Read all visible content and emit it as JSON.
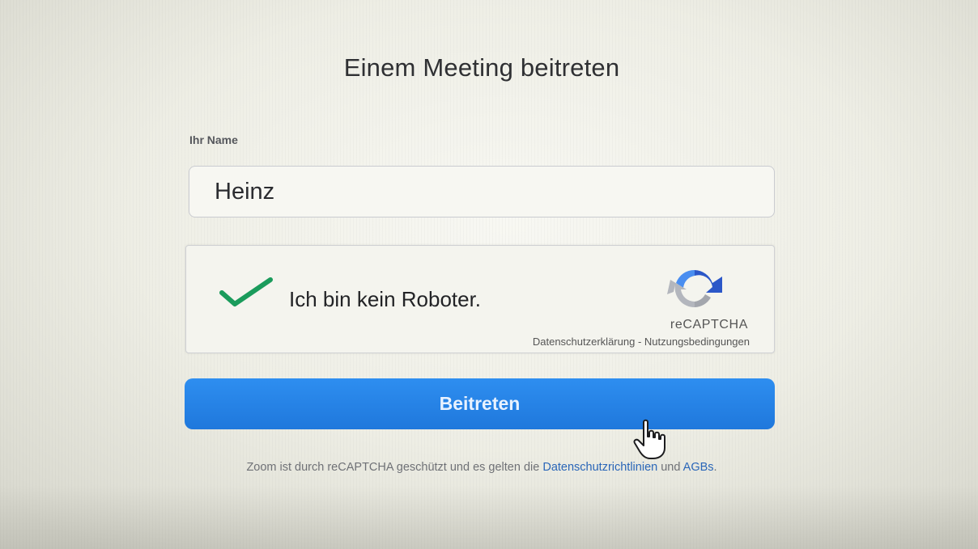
{
  "page": {
    "title": "Einem Meeting beitreten"
  },
  "form": {
    "name_label": "Ihr Name",
    "name_value": "Heinz"
  },
  "captcha": {
    "label": "Ich bin kein Roboter.",
    "checked": true,
    "brand": "reCAPTCHA",
    "privacy_link": "Datenschutzerklärung",
    "separator": " - ",
    "terms_link": "Nutzungsbedingungen",
    "check_color": "#1a9b5b"
  },
  "button": {
    "label": "Beitreten",
    "color": "#2d8cff"
  },
  "footer": {
    "text_before": "Zoom ist durch reCAPTCHA geschützt und es gelten die ",
    "privacy_link": "Datenschutzrichtlinien",
    "text_middle": " und ",
    "terms_link": "AGBs",
    "text_after": "."
  },
  "icons": {
    "check": "checkmark-icon",
    "recaptcha": "recaptcha-logo-icon",
    "cursor": "hand-pointer-icon"
  }
}
